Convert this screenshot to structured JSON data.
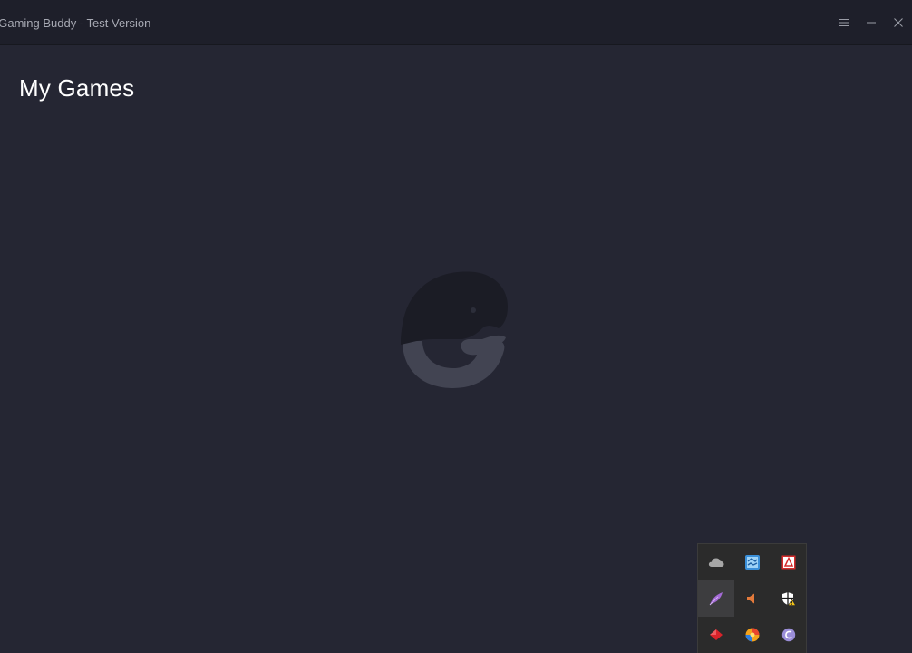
{
  "window": {
    "title": "t Gaming Buddy - Test Version"
  },
  "window_controls": [
    {
      "name": "menu",
      "icon": "hamburger-menu-icon"
    },
    {
      "name": "minimize",
      "icon": "minimize-icon"
    },
    {
      "name": "close",
      "icon": "close-icon"
    }
  ],
  "main": {
    "heading": "My Games",
    "empty_state_icon": "whale-mascot-logo"
  },
  "tray": {
    "icons": [
      {
        "icon": "onedrive-cloud-icon",
        "active": false
      },
      {
        "icon": "network-monitor-icon",
        "active": false
      },
      {
        "icon": "pdf-app-icon",
        "active": false
      },
      {
        "icon": "feather-app-icon",
        "active": true
      },
      {
        "icon": "speaker-volume-icon",
        "active": false
      },
      {
        "icon": "security-shield-warning-icon",
        "active": false
      },
      {
        "icon": "red-diamond-app-icon",
        "active": false
      },
      {
        "icon": "colorful-app-icon",
        "active": false
      },
      {
        "icon": "bittorrent-icon",
        "active": false
      }
    ]
  },
  "colors": {
    "background": "#252633",
    "titlebar": "#1e1f2a",
    "heading_text": "#ffffff",
    "title_text": "#a7a9b3",
    "tray_background": "#2b2b2b"
  }
}
